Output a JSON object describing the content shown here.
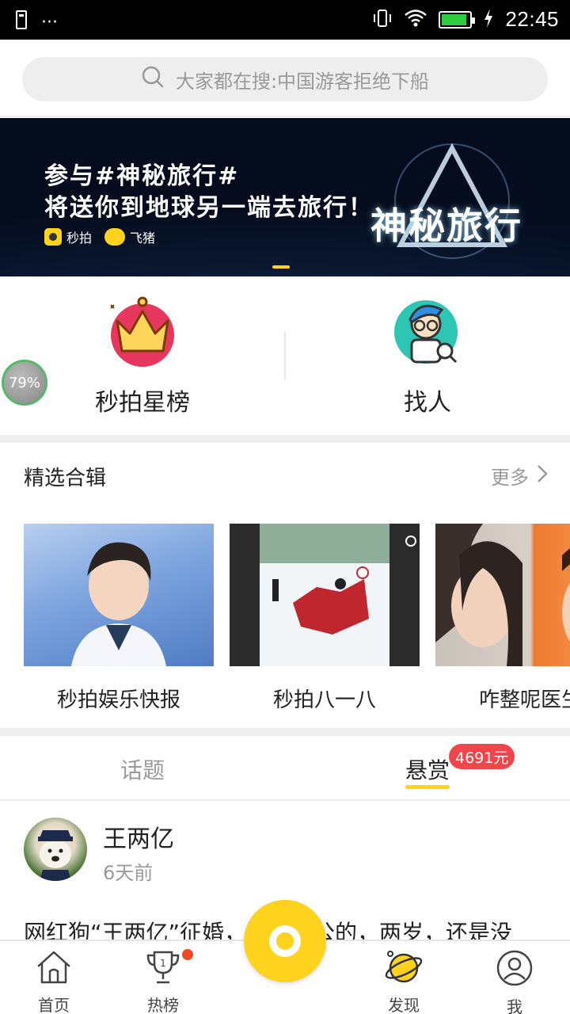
{
  "status_bar": {
    "time": "22:45",
    "left_dots": "···",
    "battery_level": 0.9,
    "icons": [
      "usb-icon",
      "vibrate-icon",
      "wifi-icon",
      "battery-icon",
      "charging-icon"
    ]
  },
  "search": {
    "placeholder": "大家都在搜:中国游客拒绝下船"
  },
  "banner": {
    "line1": "参与#神秘旅行#",
    "line2": "将送你到地球另一端去旅行！",
    "logo1": "秒拍",
    "logo2": "飞猪",
    "art_title": "神秘旅行",
    "accent_color": "#ffd21e"
  },
  "quick_entries": [
    {
      "label": "秒拍星榜",
      "icon": "crown-icon"
    },
    {
      "label": "找人",
      "icon": "find-person-icon"
    }
  ],
  "floating_badge": {
    "text": "79%"
  },
  "collections": {
    "title": "精选合辑",
    "more_label": "更多",
    "items": [
      {
        "caption": "秒拍娱乐快报"
      },
      {
        "caption": "秒拍八一八"
      },
      {
        "caption": "咋整呢医生"
      }
    ]
  },
  "tabs": {
    "topics": "话题",
    "reward": "悬赏",
    "reward_badge": "4691元",
    "active": "reward"
  },
  "post": {
    "author": "王两亿",
    "time": "6天前",
    "text": "网红狗“王两亿”征婚，本狗是公的，两岁，还是没"
  },
  "nav": {
    "items": [
      {
        "label": "首页",
        "icon": "home-icon"
      },
      {
        "label": "热榜",
        "icon": "trophy-icon"
      },
      {
        "label": "发现",
        "icon": "planet-icon"
      },
      {
        "label": "我",
        "icon": "profile-icon"
      }
    ]
  }
}
